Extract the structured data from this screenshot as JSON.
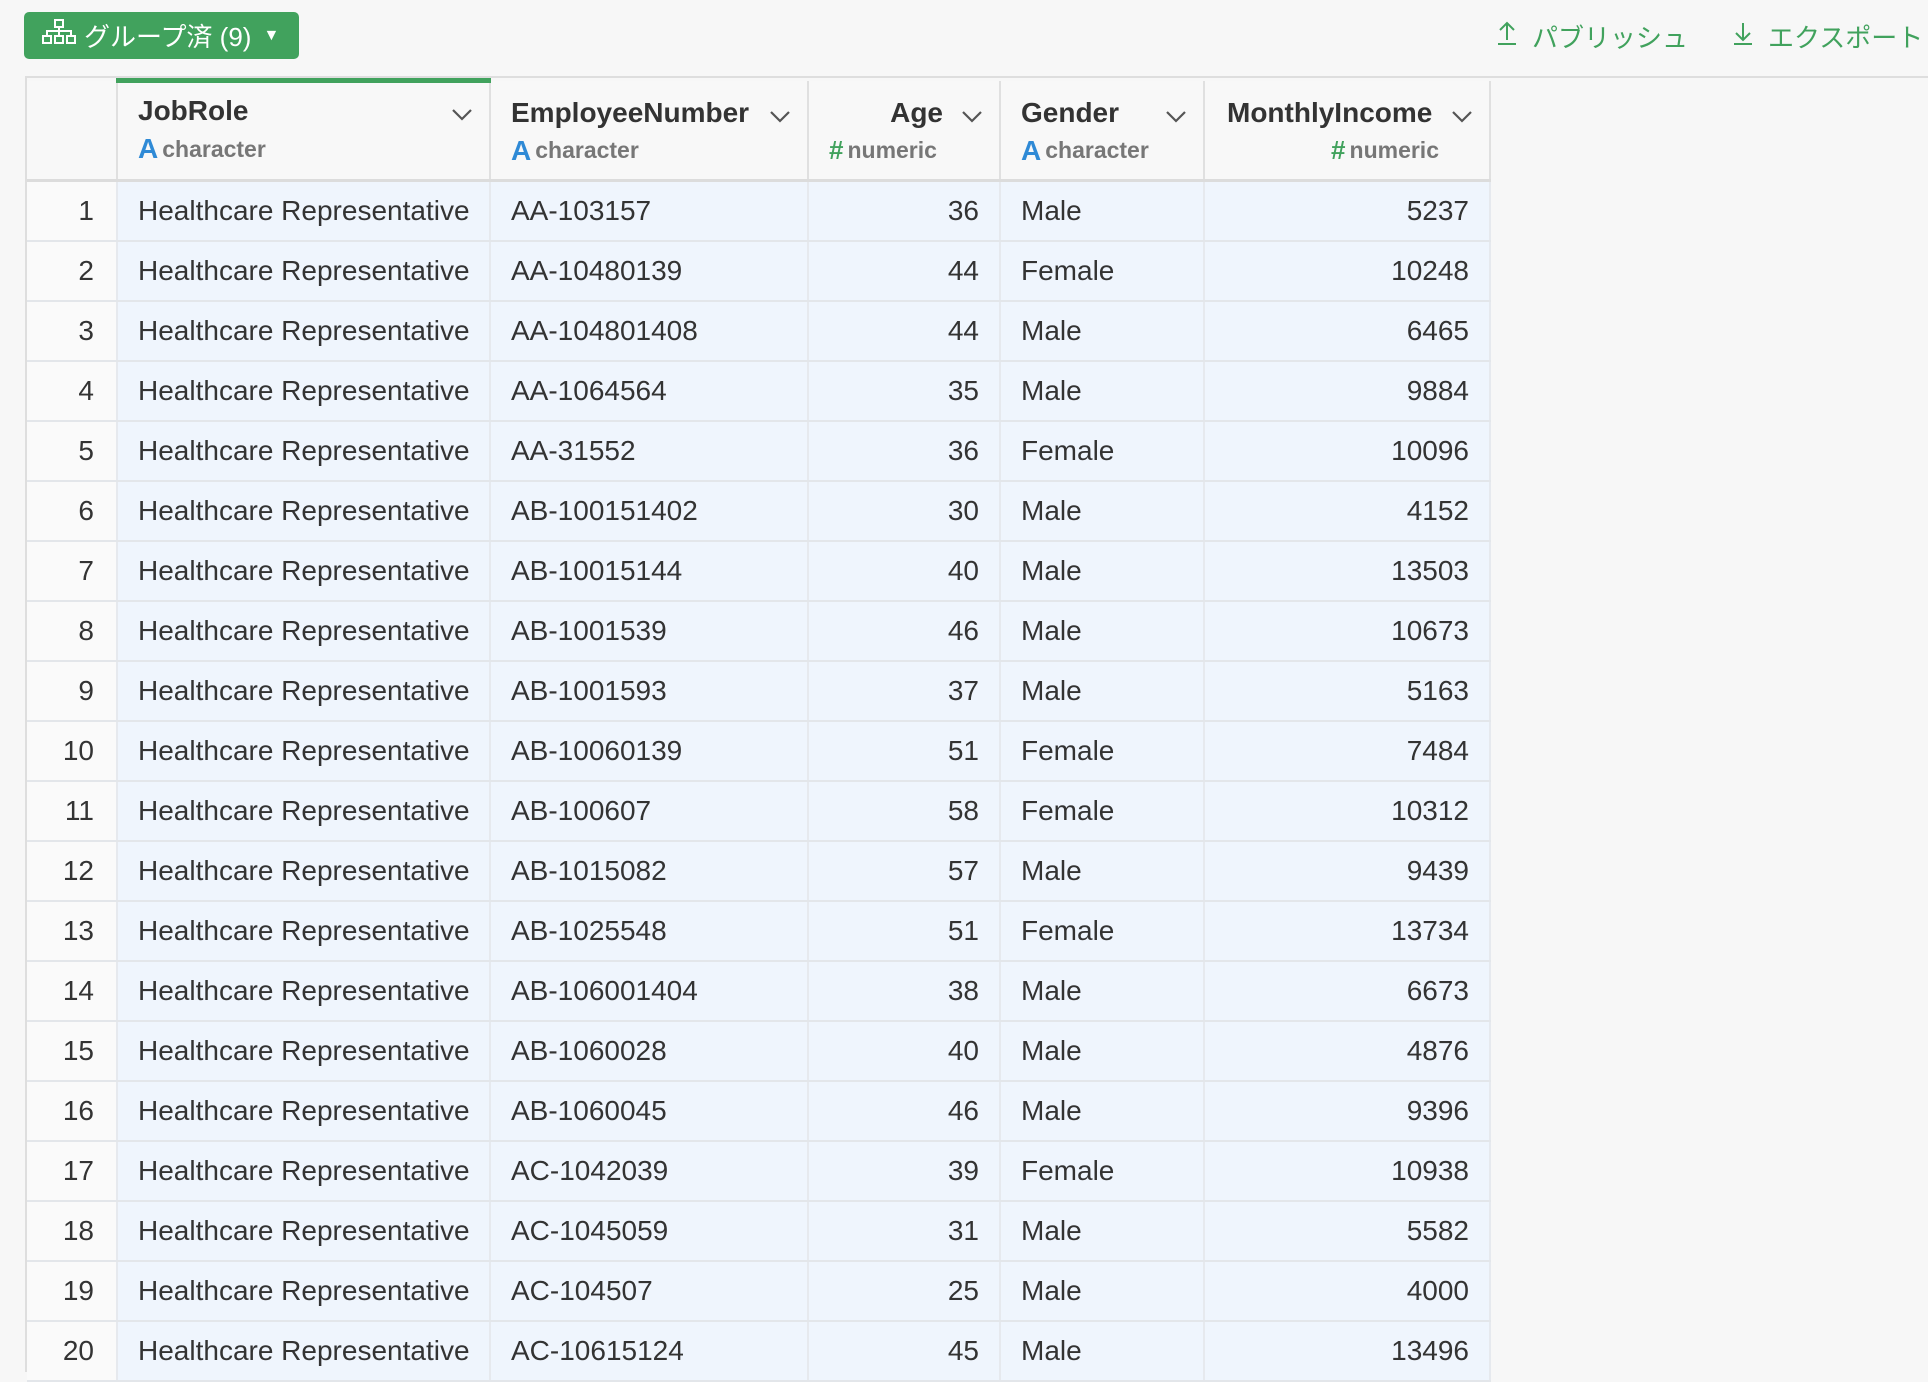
{
  "toolbar": {
    "group_button_label": "グループ済 (9)",
    "publish_label": "パブリッシュ",
    "export_label": "エクスポート"
  },
  "columns": [
    {
      "name": "JobRole",
      "type_label": "character",
      "type_icon": "A"
    },
    {
      "name": "EmployeeNumber",
      "type_label": "character",
      "type_icon": "A"
    },
    {
      "name": "Age",
      "type_label": "numeric",
      "type_icon": "#"
    },
    {
      "name": "Gender",
      "type_label": "character",
      "type_icon": "A"
    },
    {
      "name": "MonthlyIncome",
      "type_label": "numeric",
      "type_icon": "#"
    }
  ],
  "rows": [
    {
      "n": "1",
      "job": "Healthcare Representative",
      "emp": "AA-103157",
      "age": "36",
      "gender": "Male",
      "income": "5237"
    },
    {
      "n": "2",
      "job": "Healthcare Representative",
      "emp": "AA-10480139",
      "age": "44",
      "gender": "Female",
      "income": "10248"
    },
    {
      "n": "3",
      "job": "Healthcare Representative",
      "emp": "AA-104801408",
      "age": "44",
      "gender": "Male",
      "income": "6465"
    },
    {
      "n": "4",
      "job": "Healthcare Representative",
      "emp": "AA-1064564",
      "age": "35",
      "gender": "Male",
      "income": "9884"
    },
    {
      "n": "5",
      "job": "Healthcare Representative",
      "emp": "AA-31552",
      "age": "36",
      "gender": "Female",
      "income": "10096"
    },
    {
      "n": "6",
      "job": "Healthcare Representative",
      "emp": "AB-100151402",
      "age": "30",
      "gender": "Male",
      "income": "4152"
    },
    {
      "n": "7",
      "job": "Healthcare Representative",
      "emp": "AB-10015144",
      "age": "40",
      "gender": "Male",
      "income": "13503"
    },
    {
      "n": "8",
      "job": "Healthcare Representative",
      "emp": "AB-1001539",
      "age": "46",
      "gender": "Male",
      "income": "10673"
    },
    {
      "n": "9",
      "job": "Healthcare Representative",
      "emp": "AB-1001593",
      "age": "37",
      "gender": "Male",
      "income": "5163"
    },
    {
      "n": "10",
      "job": "Healthcare Representative",
      "emp": "AB-10060139",
      "age": "51",
      "gender": "Female",
      "income": "7484"
    },
    {
      "n": "11",
      "job": "Healthcare Representative",
      "emp": "AB-100607",
      "age": "58",
      "gender": "Female",
      "income": "10312"
    },
    {
      "n": "12",
      "job": "Healthcare Representative",
      "emp": "AB-1015082",
      "age": "57",
      "gender": "Male",
      "income": "9439"
    },
    {
      "n": "13",
      "job": "Healthcare Representative",
      "emp": "AB-1025548",
      "age": "51",
      "gender": "Female",
      "income": "13734"
    },
    {
      "n": "14",
      "job": "Healthcare Representative",
      "emp": "AB-106001404",
      "age": "38",
      "gender": "Male",
      "income": "6673"
    },
    {
      "n": "15",
      "job": "Healthcare Representative",
      "emp": "AB-1060028",
      "age": "40",
      "gender": "Male",
      "income": "4876"
    },
    {
      "n": "16",
      "job": "Healthcare Representative",
      "emp": "AB-1060045",
      "age": "46",
      "gender": "Male",
      "income": "9396"
    },
    {
      "n": "17",
      "job": "Healthcare Representative",
      "emp": "AC-1042039",
      "age": "39",
      "gender": "Female",
      "income": "10938"
    },
    {
      "n": "18",
      "job": "Healthcare Representative",
      "emp": "AC-1045059",
      "age": "31",
      "gender": "Male",
      "income": "5582"
    },
    {
      "n": "19",
      "job": "Healthcare Representative",
      "emp": "AC-104507",
      "age": "25",
      "gender": "Male",
      "income": "4000"
    },
    {
      "n": "20",
      "job": "Healthcare Representative",
      "emp": "AC-10615124",
      "age": "45",
      "gender": "Male",
      "income": "13496"
    }
  ],
  "colors": {
    "accent_green": "#41a25d",
    "type_blue": "#2f8ad6",
    "cell_bg": "#eff5fd"
  }
}
